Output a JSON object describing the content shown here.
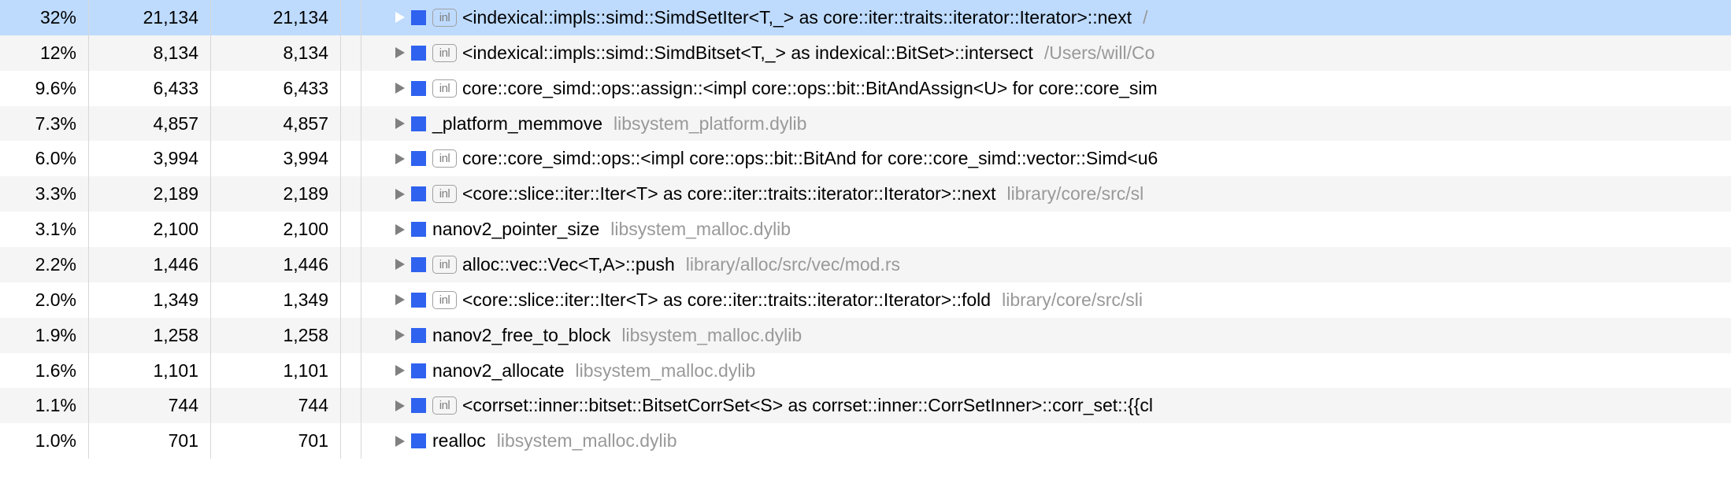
{
  "inl_label": "inl",
  "rows": [
    {
      "pct": "32%",
      "count1": "21,134",
      "count2": "21,134",
      "selected": true,
      "arrow": "open",
      "inl": true,
      "name": "<indexical::impls::simd::SimdSetIter<T,_> as core::iter::traits::iterator::Iterator>::next",
      "path": "/"
    },
    {
      "pct": "12%",
      "count1": "8,134",
      "count2": "8,134",
      "selected": false,
      "arrow": "closed",
      "inl": true,
      "name": "<indexical::impls::simd::SimdBitset<T,_> as indexical::BitSet>::intersect",
      "path": "/Users/will/Co"
    },
    {
      "pct": "9.6%",
      "count1": "6,433",
      "count2": "6,433",
      "selected": false,
      "arrow": "closed",
      "inl": true,
      "name": "core::core_simd::ops::assign::<impl core::ops::bit::BitAndAssign<U> for core::core_sim",
      "path": ""
    },
    {
      "pct": "7.3%",
      "count1": "4,857",
      "count2": "4,857",
      "selected": false,
      "arrow": "closed",
      "inl": false,
      "name": "_platform_memmove",
      "path": "libsystem_platform.dylib"
    },
    {
      "pct": "6.0%",
      "count1": "3,994",
      "count2": "3,994",
      "selected": false,
      "arrow": "closed",
      "inl": true,
      "name": "core::core_simd::ops::<impl core::ops::bit::BitAnd for core::core_simd::vector::Simd<u6",
      "path": ""
    },
    {
      "pct": "3.3%",
      "count1": "2,189",
      "count2": "2,189",
      "selected": false,
      "arrow": "closed",
      "inl": true,
      "name": "<core::slice::iter::Iter<T> as core::iter::traits::iterator::Iterator>::next",
      "path": "library/core/src/sl"
    },
    {
      "pct": "3.1%",
      "count1": "2,100",
      "count2": "2,100",
      "selected": false,
      "arrow": "closed",
      "inl": false,
      "name": "nanov2_pointer_size",
      "path": "libsystem_malloc.dylib"
    },
    {
      "pct": "2.2%",
      "count1": "1,446",
      "count2": "1,446",
      "selected": false,
      "arrow": "closed",
      "inl": true,
      "name": "alloc::vec::Vec<T,A>::push",
      "path": "library/alloc/src/vec/mod.rs"
    },
    {
      "pct": "2.0%",
      "count1": "1,349",
      "count2": "1,349",
      "selected": false,
      "arrow": "closed",
      "inl": true,
      "name": "<core::slice::iter::Iter<T> as core::iter::traits::iterator::Iterator>::fold",
      "path": "library/core/src/sli"
    },
    {
      "pct": "1.9%",
      "count1": "1,258",
      "count2": "1,258",
      "selected": false,
      "arrow": "closed",
      "inl": false,
      "name": "nanov2_free_to_block",
      "path": "libsystem_malloc.dylib"
    },
    {
      "pct": "1.6%",
      "count1": "1,101",
      "count2": "1,101",
      "selected": false,
      "arrow": "closed",
      "inl": false,
      "name": "nanov2_allocate",
      "path": "libsystem_malloc.dylib"
    },
    {
      "pct": "1.1%",
      "count1": "744",
      "count2": "744",
      "selected": false,
      "arrow": "closed",
      "inl": true,
      "name": "<corrset::inner::bitset::BitsetCorrSet<S> as corrset::inner::CorrSetInner>::corr_set::{{cl",
      "path": ""
    },
    {
      "pct": "1.0%",
      "count1": "701",
      "count2": "701",
      "selected": false,
      "arrow": "closed",
      "inl": false,
      "name": "realloc",
      "path": "libsystem_malloc.dylib"
    }
  ]
}
